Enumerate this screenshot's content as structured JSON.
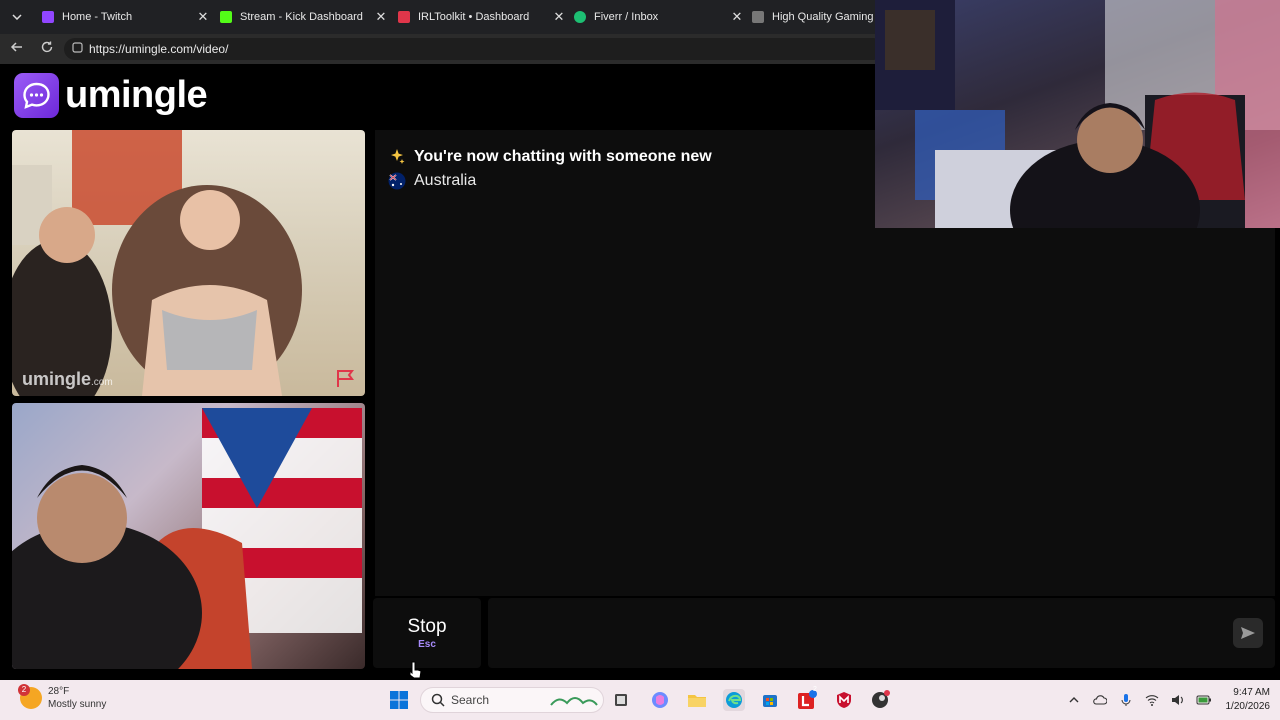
{
  "browser": {
    "tabs": [
      {
        "title": "Home - Twitch",
        "color": "#9146ff"
      },
      {
        "title": "Stream - Kick Dashboard",
        "color": "#53fc18"
      },
      {
        "title": "IRLToolkit • Dashboard",
        "color": "#e0364a"
      },
      {
        "title": "Fiverr / Inbox",
        "color": "#1dbf73"
      },
      {
        "title": "High Quality Gaming Ge",
        "color": "#777777"
      }
    ],
    "url": "https://umingle.com/video/"
  },
  "page": {
    "logo_text": "umingle",
    "watermark": "umingle",
    "watermark_suffix": ".com",
    "chat": {
      "status": "You're now chatting with someone new",
      "country": "Australia"
    },
    "stop_button": {
      "label": "Stop",
      "shortcut": "Esc"
    },
    "accent": "#7c3aed"
  },
  "taskbar": {
    "weather": {
      "temp": "28°F",
      "condition": "Mostly sunny",
      "badge": "2"
    },
    "search_label": "Search",
    "clock": {
      "time": "9:47 AM",
      "date": "1/20/2026"
    },
    "app_badge": "2"
  }
}
